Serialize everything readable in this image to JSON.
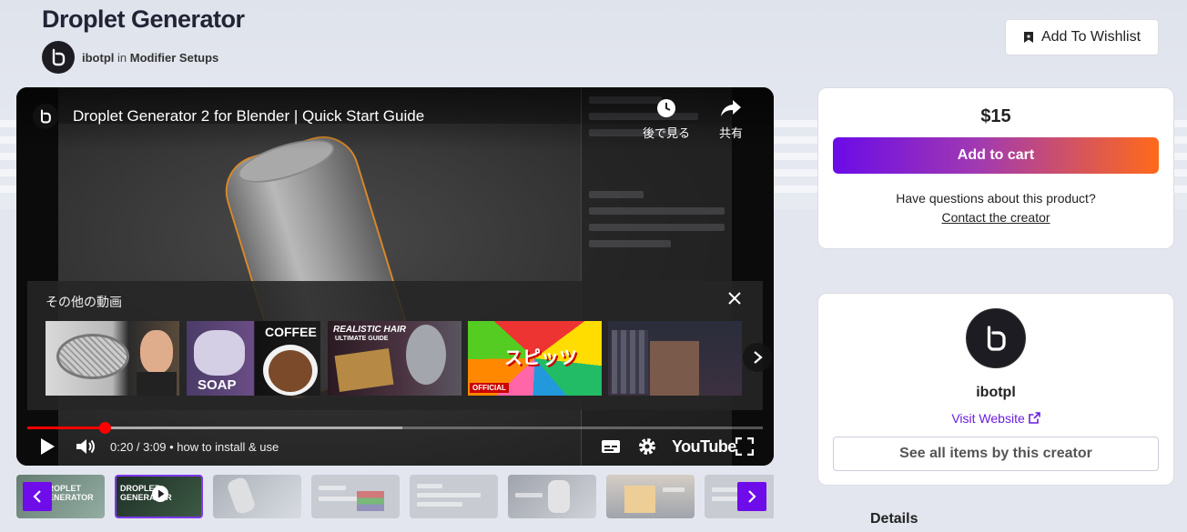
{
  "product": {
    "title": "Droplet Generator",
    "creator": "ibotpl",
    "in_word": "in",
    "category": "Modifier Setups"
  },
  "wishlist": {
    "label": "Add To Wishlist",
    "icon": "bookmark-icon"
  },
  "video": {
    "title": "Droplet Generator 2 for Blender | Quick Start Guide",
    "watch_later": "後で見る",
    "share": "共有",
    "more_videos_title": "その他の動画",
    "current_time": "0:20 / 3:09",
    "chapter": "• how to install & use",
    "progress_fraction": 0.1058,
    "buffer_fraction": 0.51,
    "platform": "YouTube",
    "related_thumbnails": [
      {
        "text": ""
      },
      {
        "text": "SOAP",
        "text2": "COFFEE"
      },
      {
        "text": "REALISTIC HAIR",
        "text2": "ULTIMATE GUIDE"
      },
      {
        "text": "スピッツ",
        "text2": "OFFICIAL"
      },
      {
        "text": ""
      }
    ]
  },
  "gallery": {
    "count": 8,
    "active_index": 1,
    "thumb_labels": [
      "DROPLET GENERATOR",
      "DROPLET GENERATOR"
    ]
  },
  "purchase": {
    "price": "$15",
    "cart_label": "Add to cart",
    "question": "Have questions about this product?",
    "contact_label": "Contact the creator"
  },
  "creator_card": {
    "name": "ibotpl",
    "visit_label": "Visit Website",
    "see_all_label": "See all items by this creator"
  },
  "details": {
    "heading": "Details"
  },
  "colors": {
    "accent": "#6f0cea",
    "cart_gradient_start": "#6b0be8",
    "cart_gradient_end": "#ff6a1a",
    "link": "#6a1de0",
    "progress": "#ff0000"
  }
}
